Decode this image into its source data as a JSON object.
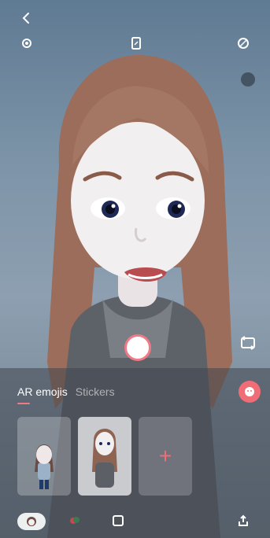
{
  "top_bar": {
    "icons": [
      "back-icon",
      "settings-icon",
      "aspect-ratio-icon",
      "beauty-off-icon"
    ]
  },
  "tabs": [
    {
      "label": "AR emojis",
      "active": true
    },
    {
      "label": "Stickers",
      "active": false
    }
  ],
  "add_label": "+",
  "bottom_icons": [
    "avatar-icon",
    "decor-icon",
    "frame-icon",
    "share-icon"
  ],
  "colors": {
    "accent": "#f06d78"
  }
}
